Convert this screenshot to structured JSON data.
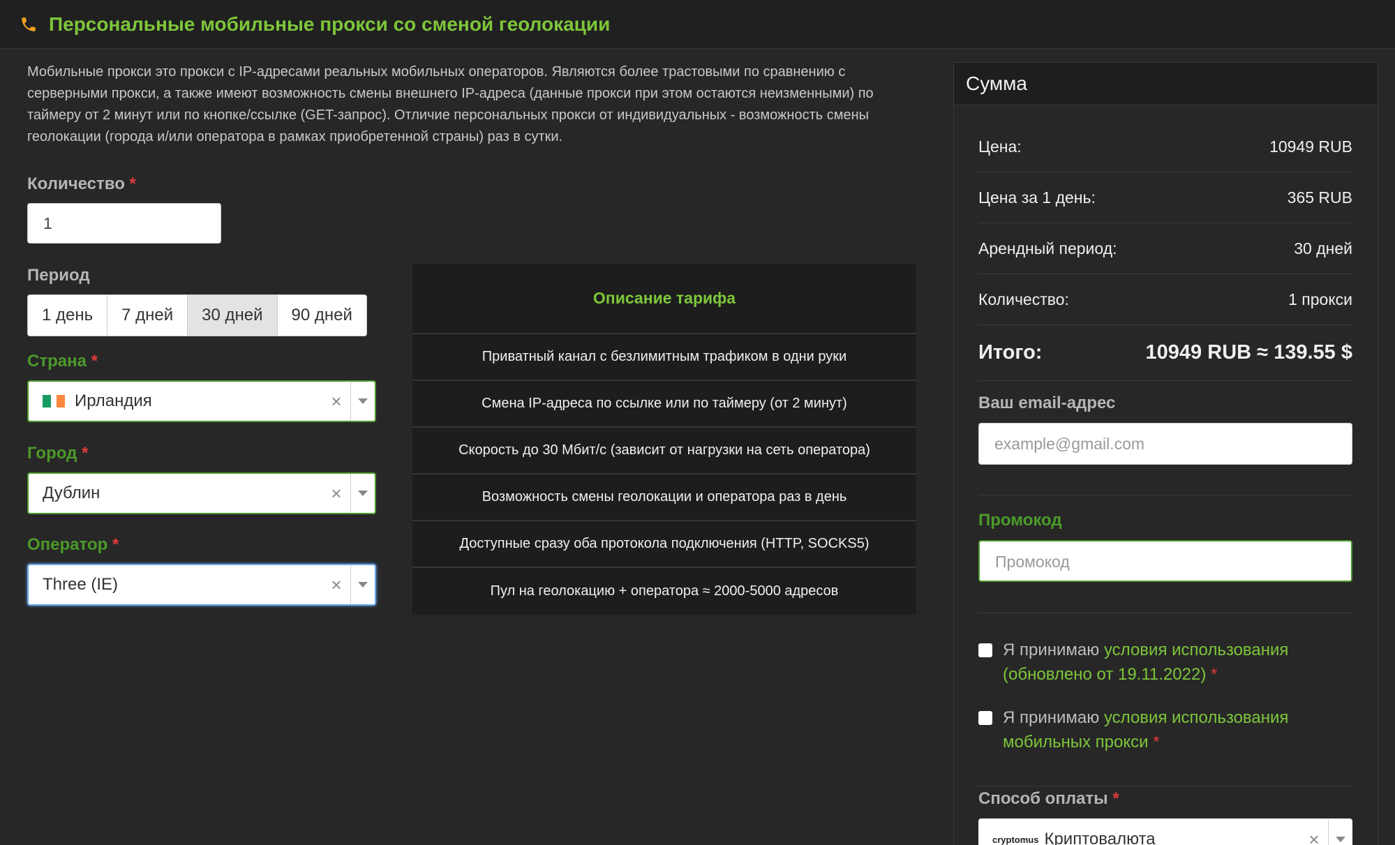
{
  "header": {
    "title": "Персональные мобильные прокси со сменой геолокации",
    "icon": "phone-icon"
  },
  "description": "Мобильные прокси это прокси с IP-адресами реальных мобильных операторов. Являются более трастовыми по сравнению с серверными прокси, а также имеют возможность смены внешнего IP-адреса (данные прокси при этом остаются неизменными) по таймеру от 2 минут или по кнопке/ссылке (GET-запрос). Отличие персональных прокси от индивидуальных - возможность смены геолокации (города и/или оператора в рамках приобретенной страны) раз в сутки.",
  "form": {
    "quantity_label": "Количество",
    "quantity_value": "1",
    "period_label": "Период",
    "periods": [
      "1 день",
      "7 дней",
      "30 дней",
      "90 дней"
    ],
    "period_selected": "30 дней",
    "country_label": "Страна",
    "country_value": "Ирландия",
    "city_label": "Город",
    "city_value": "Дублин",
    "operator_label": "Оператор",
    "operator_value": "Three (IE)",
    "required_mark": "*",
    "clear_symbol": "×"
  },
  "tariff": {
    "title": "Описание тарифа",
    "rows": [
      "Приватный канал с безлимитным трафиком в одни руки",
      "Смена IP-адреса по ссылке или по таймеру (от 2 минут)",
      "Скорость до 30 Мбит/с (зависит от нагрузки на сеть оператора)",
      "Возможность смены геолокации и оператора раз в день",
      "Доступные сразу оба протокола подключения (HTTP, SOCKS5)",
      "Пул на геолокацию + оператора ≈ 2000-5000 адресов"
    ]
  },
  "summary": {
    "title": "Сумма",
    "price_label": "Цена:",
    "price_value": "10949 RUB",
    "daily_label": "Цена за 1 день:",
    "daily_value": "365 RUB",
    "period_label": "Арендный период:",
    "period_value": "30 дней",
    "qty_label": "Количество:",
    "qty_value": "1 прокси",
    "total_label": "Итого:",
    "total_value": "10949 RUB ≈ 139.55 $",
    "email_label": "Ваш email-адрес",
    "email_placeholder": "example@gmail.com",
    "promo_label": "Промокод",
    "promo_placeholder": "Промокод",
    "terms1_prefix": "Я принимаю ",
    "terms1_link": "условия использования (обновлено от 19.11.2022)",
    "terms2_prefix": "Я принимаю ",
    "terms2_link": "условия использования мобильных прокси",
    "payment_label": "Способ оплаты",
    "payment_brand": "cryptomus",
    "payment_value": "Криптовалюта"
  },
  "colors": {
    "accent": "#7dc63a",
    "label_green": "#4c9a2a",
    "required": "#e23b3b",
    "background": "#272727"
  }
}
